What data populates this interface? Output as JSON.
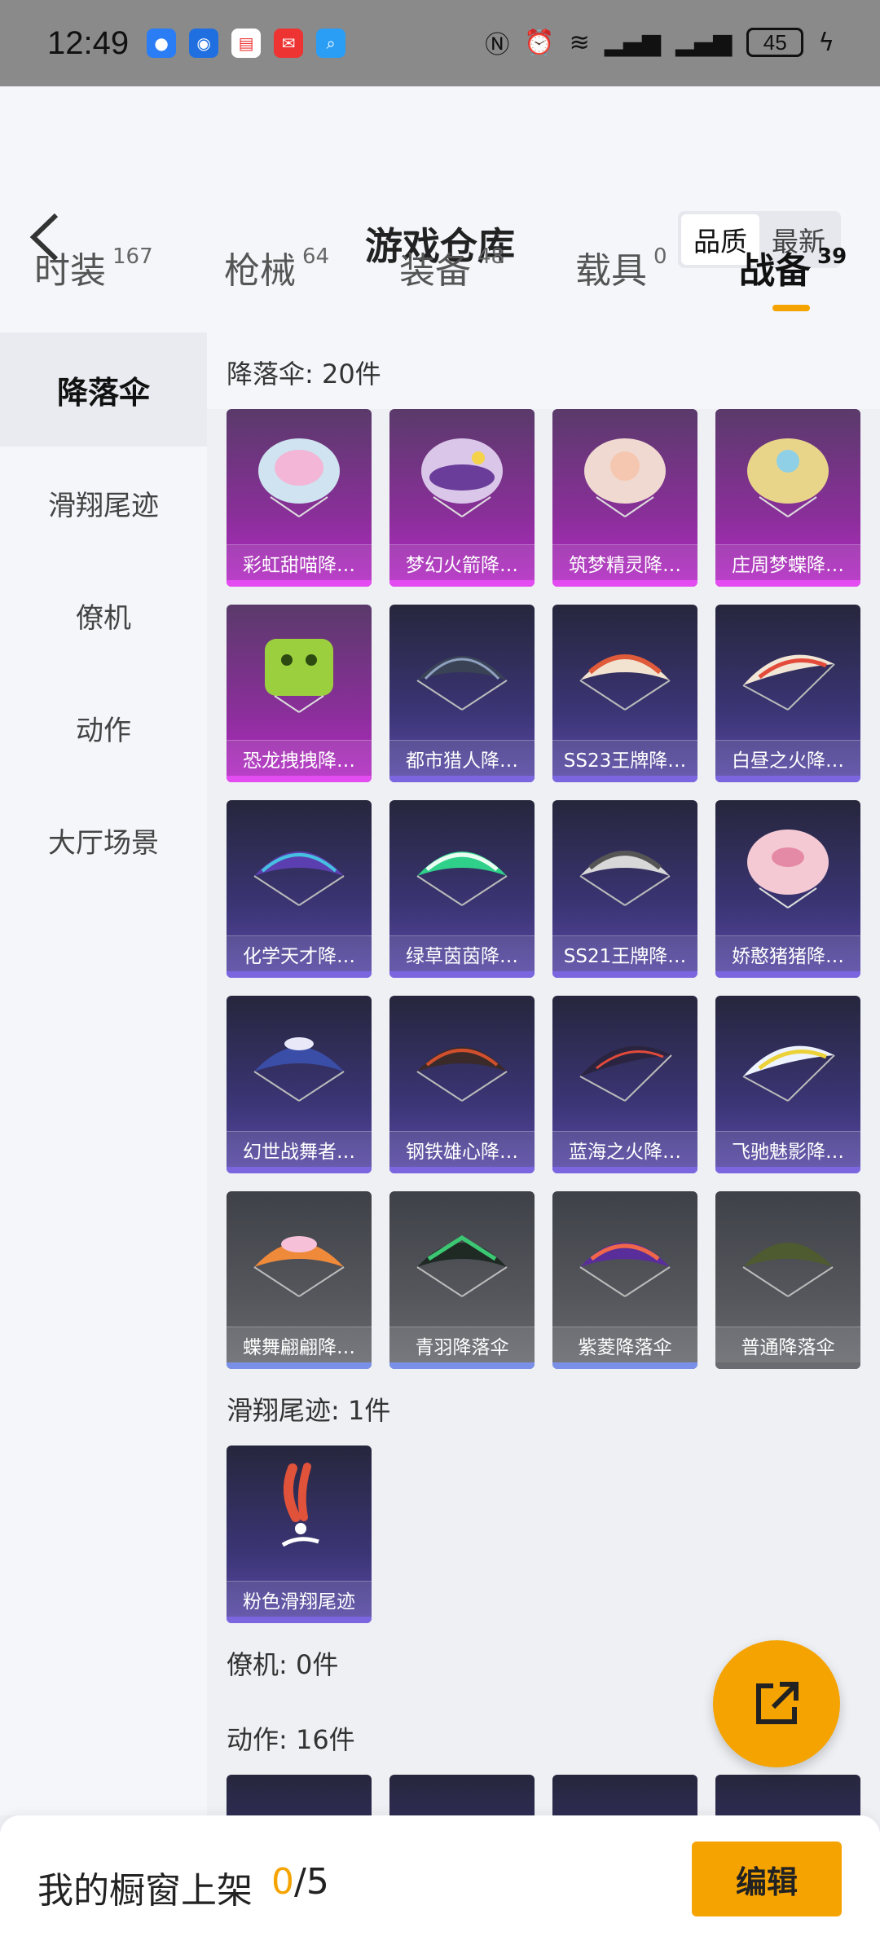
{
  "status_bar": {
    "time": "12:49",
    "battery": "45"
  },
  "header": {
    "title": "游戏仓库",
    "sort_options": [
      "品质",
      "最新"
    ]
  },
  "tabs": [
    {
      "label": "时装",
      "count": "167"
    },
    {
      "label": "枪械",
      "count": "64"
    },
    {
      "label": "装备",
      "count": "48"
    },
    {
      "label": "载具",
      "count": "0"
    },
    {
      "label": "战备",
      "count": "39"
    }
  ],
  "sidebar": {
    "items": [
      "降落伞",
      "滑翔尾迹",
      "僚机",
      "动作",
      "大厅场景"
    ]
  },
  "sections": {
    "parachutes": {
      "title": "降落伞: 20件",
      "items": [
        "彩虹甜喵降…",
        "梦幻火箭降…",
        "筑梦精灵降…",
        "庄周梦蝶降…",
        "恐龙拽拽降…",
        "都市猎人降…",
        "SS23王牌降…",
        "白昼之火降…",
        "化学天才降…",
        "绿草茵茵降…",
        "SS21王牌降…",
        "娇憨猪猪降…",
        "幻世战舞者…",
        "钢铁雄心降…",
        "蓝海之火降…",
        "飞驰魅影降…",
        "蝶舞翩翩降…",
        "青羽降落伞",
        "紫菱降落伞",
        "普通降落伞"
      ]
    },
    "trails": {
      "title": "滑翔尾迹: 1件",
      "items": [
        "粉色滑翔尾迹"
      ]
    },
    "wingman": {
      "title": "僚机: 0件"
    },
    "actions": {
      "title": "动作: 16件"
    }
  },
  "footer": {
    "label": "我的橱窗上架",
    "count_current": "0",
    "count_total": "/5",
    "edit_label": "编辑"
  },
  "colors": {
    "accent": "#f5a300",
    "quality_pink": "#b52ac5",
    "quality_purple": "#5a4aa8",
    "quality_gray": "#55575d"
  },
  "icons": {
    "back": "chevron-left-icon",
    "share": "share-external-icon"
  }
}
